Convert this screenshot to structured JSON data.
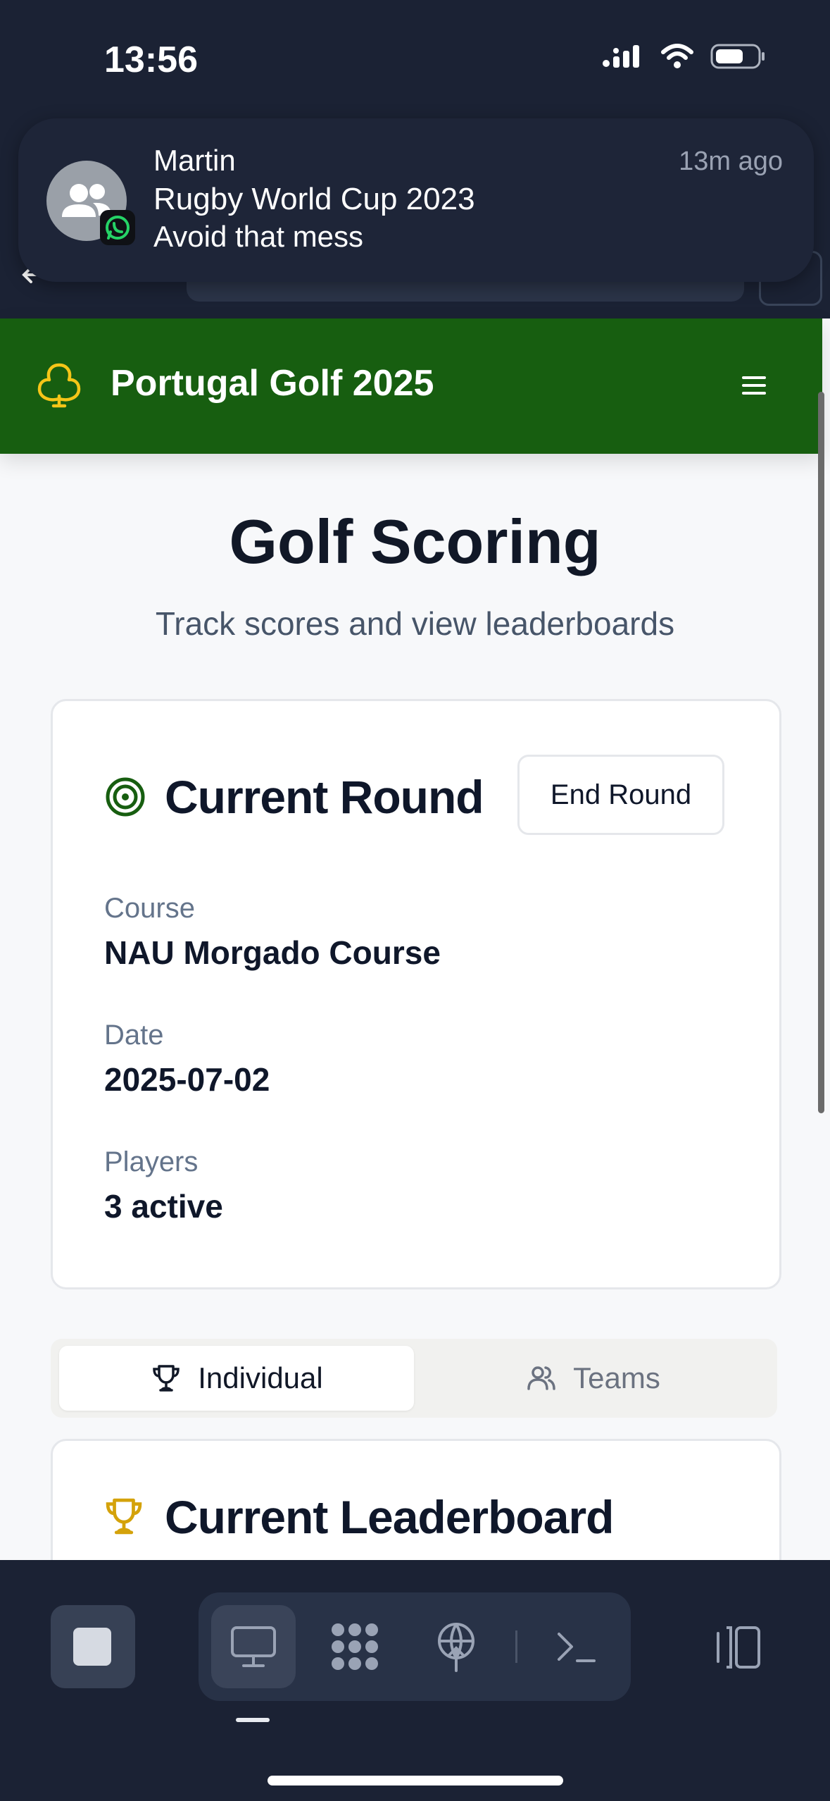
{
  "status_bar": {
    "time": "13:56"
  },
  "notification": {
    "sender": "Martin",
    "title": "Rugby World Cup 2023",
    "body": "Avoid that mess",
    "time": "13m ago",
    "app_icon": "whatsapp-icon"
  },
  "header": {
    "title": "Portugal Golf 2025",
    "logo_icon": "club-icon",
    "menu_icon": "hamburger-icon"
  },
  "page": {
    "heading": "Golf Scoring",
    "subheading": "Track scores and view leaderboards"
  },
  "current_round": {
    "title": "Current Round",
    "end_button": "End Round",
    "fields": [
      {
        "label": "Course",
        "value": "NAU Morgado Course"
      },
      {
        "label": "Date",
        "value": "2025-07-02"
      },
      {
        "label": "Players",
        "value": "3 active"
      }
    ]
  },
  "tabs": [
    {
      "label": "Individual",
      "icon": "trophy-icon",
      "active": true
    },
    {
      "label": "Teams",
      "icon": "users-icon",
      "active": false
    }
  ],
  "leaderboard": {
    "title": "Current Leaderboard"
  },
  "colors": {
    "header_bg": "#175e10",
    "accent_green": "#175e10",
    "trophy_gold": "#d4a20a",
    "dark_chrome": "#1b2234"
  },
  "dock": {
    "items": [
      "stop-icon",
      "monitor-icon",
      "apps-icon",
      "network-icon",
      "terminal-icon",
      "sidebar-icon"
    ]
  }
}
